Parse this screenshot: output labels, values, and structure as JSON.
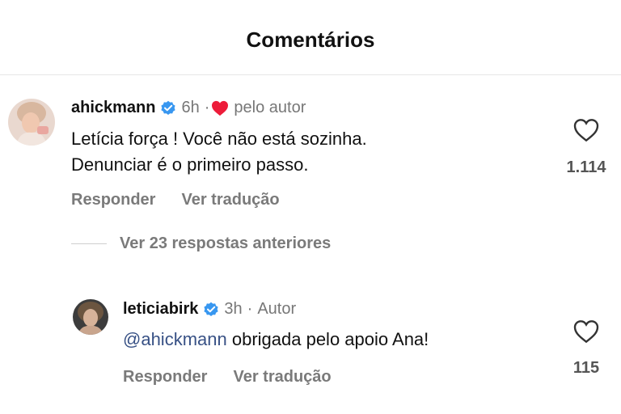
{
  "header": {
    "title": "Comentários"
  },
  "comments": [
    {
      "username": "ahickmann",
      "time": "6h",
      "separator": "·",
      "liked_by_author": "pelo autor",
      "text_line1": "Letícia força ! Você não está sozinha.",
      "text_line2": "Denunciar é o primeiro passo.",
      "reply_label": "Responder",
      "translate_label": "Ver tradução",
      "likes": "1.114"
    }
  ],
  "replies": {
    "view_more": "Ver 23 respostas anteriores",
    "items": [
      {
        "username": "leticiabirk",
        "time": "3h",
        "separator": "·",
        "author_badge": "Autor",
        "mention": "@ahickmann",
        "text": " obrigada pelo apoio Ana!",
        "reply_label": "Responder",
        "translate_label": "Ver tradução",
        "likes": "115"
      }
    ]
  },
  "colors": {
    "verified": "#3897f0",
    "heart_red": "#ed1c3a",
    "mention": "#385185"
  }
}
